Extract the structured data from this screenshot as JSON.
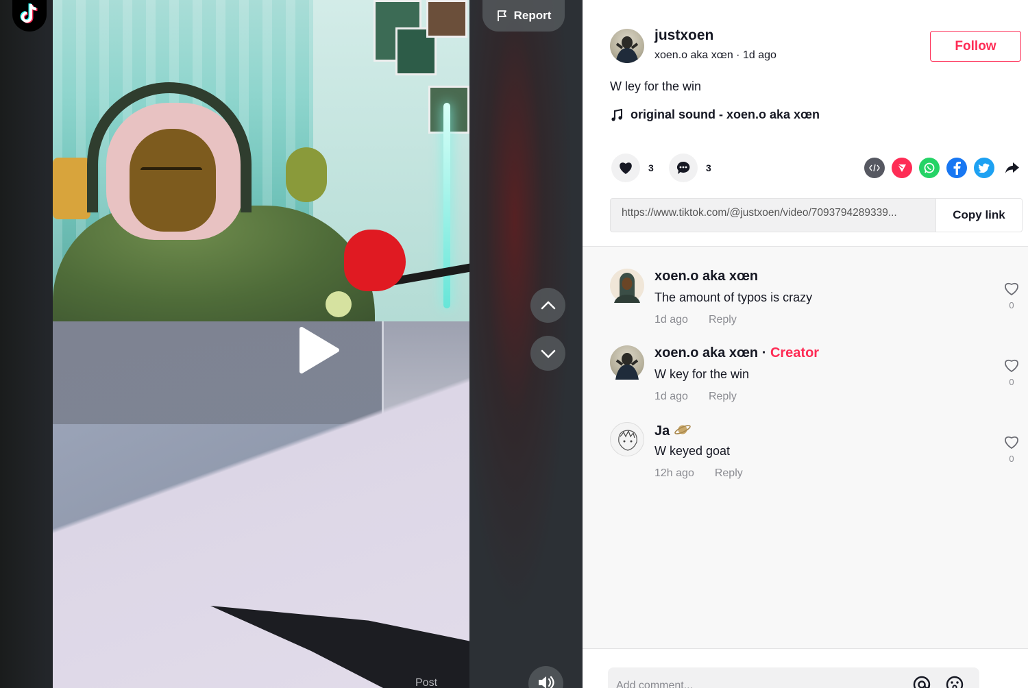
{
  "video": {
    "report_label": "Report"
  },
  "author": {
    "username": "justxoen",
    "meta": "xoen.o aka xœn · 1d ago",
    "follow_label": "Follow"
  },
  "post": {
    "caption": "W ley for the win",
    "sound": "original sound - xoen.o aka xœn",
    "likes": "3",
    "comments": "3",
    "share_icons": [
      "embed-icon",
      "send-icon",
      "whatsapp-icon",
      "facebook-icon",
      "twitter-icon",
      "share-arrow-icon"
    ],
    "link": "https://www.tiktok.com/@justxoen/video/7093794289339...",
    "copy_label": "Copy link"
  },
  "comments": [
    {
      "name": "xoen.o aka xœn",
      "creator": "",
      "text": "The amount of typos is crazy",
      "time": "1d ago",
      "reply": "Reply",
      "likes": "0"
    },
    {
      "name": "xoen.o aka xœn",
      "creator": "Creator",
      "text": "W key for the win",
      "time": "1d ago",
      "reply": "Reply",
      "likes": "0"
    },
    {
      "name": "Ja",
      "creator": "",
      "text": "W keyed goat",
      "time": "12h ago",
      "reply": "Reply",
      "likes": "0"
    }
  ],
  "composer": {
    "placeholder": "Add comment...",
    "post_label": "Post"
  },
  "colors": {
    "accent": "#fe2c55",
    "text": "#161823",
    "muted": "#8a8b91"
  }
}
